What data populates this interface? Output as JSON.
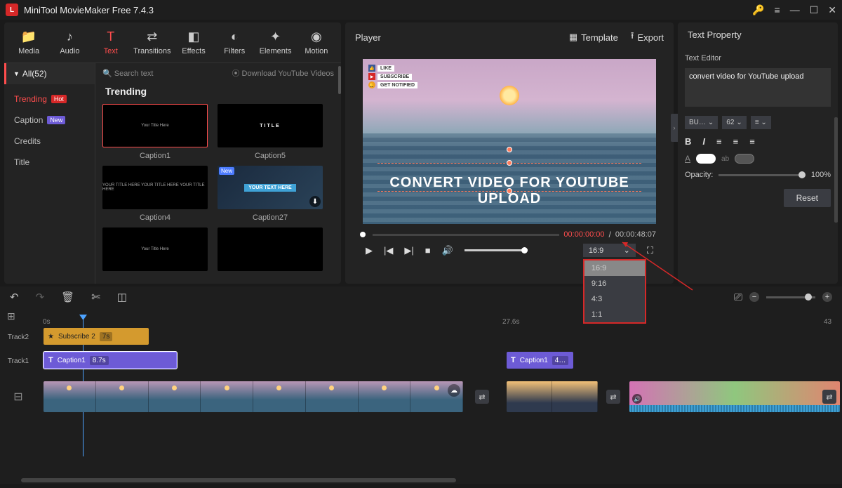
{
  "titlebar": {
    "app_name": "MiniTool MovieMaker Free 7.4.3"
  },
  "toolbar": {
    "media": "Media",
    "audio": "Audio",
    "text": "Text",
    "transitions": "Transitions",
    "effects": "Effects",
    "filters": "Filters",
    "elements": "Elements",
    "motion": "Motion"
  },
  "categories": {
    "all": "All(52)",
    "items": [
      {
        "label": "Trending",
        "badge": "Hot"
      },
      {
        "label": "Caption",
        "badge": "New"
      },
      {
        "label": "Credits"
      },
      {
        "label": "Title"
      }
    ]
  },
  "asset_tools": {
    "search_placeholder": "Search text",
    "download_label": "Download YouTube Videos"
  },
  "grid": {
    "title": "Trending",
    "caption1": "Caption1",
    "caption5": "Caption5",
    "caption4": "Caption4",
    "caption27": "Caption27",
    "your_title": "Your Title Here",
    "title_word": "TITLE",
    "caption4_text": "YOUR TITLE HERE YOUR TITLE HERE YOUR TITLE HERE",
    "caption27_text": "YOUR TEXT HERE",
    "new_badge": "New"
  },
  "player": {
    "title": "Player",
    "template": "Template",
    "export": "Export",
    "overlays": {
      "like": "LIKE",
      "subscribe": "SUBSCRIBE",
      "notify": "GET NOTIFIED"
    },
    "headline": "CONVERT VIDEO FOR YOUTUBE UPLOAD",
    "time_current": "00:00:00:00",
    "time_total": "00:00:48:07",
    "ratio": {
      "selected": "16:9",
      "options": [
        "16:9",
        "9:16",
        "4:3",
        "1:1"
      ]
    }
  },
  "props": {
    "title": "Text Property",
    "editor_label": "Text Editor",
    "text_value": "convert video for YouTube upload",
    "font_name": "BU…",
    "font_size": "62",
    "opacity_label": "Opacity:",
    "opacity_value": "100%",
    "reset": "Reset"
  },
  "timeline": {
    "ruler": {
      "t0": "0s",
      "t1": "27.6s",
      "t2": "43"
    },
    "track2": "Track2",
    "track1": "Track1",
    "clip_sub": "Subscribe 2",
    "clip_sub_dur": "7s",
    "clip_cap": "Caption1",
    "clip_cap_dur": "8.7s",
    "clip_cap2": "Caption1",
    "clip_cap2_dur": "4…"
  }
}
